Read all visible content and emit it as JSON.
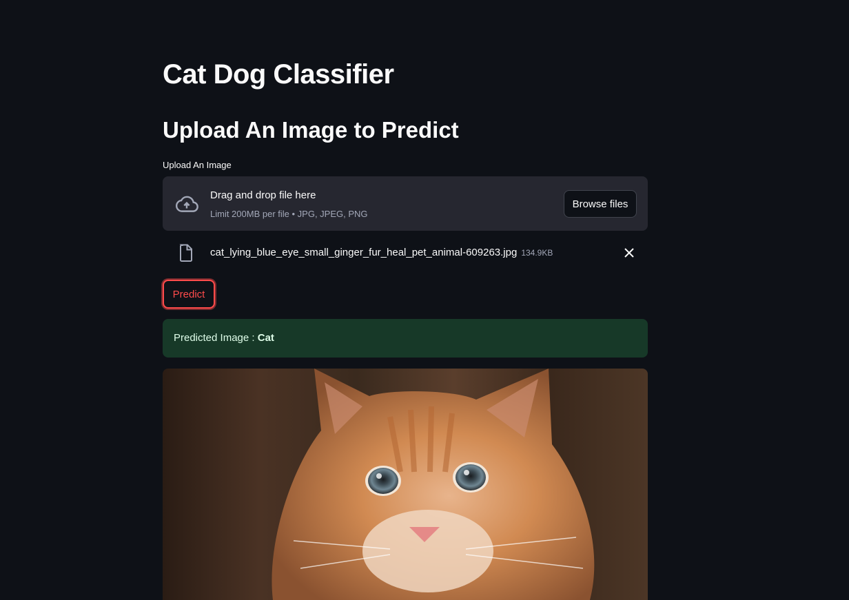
{
  "header": {
    "title": "Cat Dog Classifier",
    "subtitle": "Upload An Image to Predict"
  },
  "uploader": {
    "label": "Upload An Image",
    "drag_text": "Drag and drop file here",
    "limit_text": "Limit 200MB per file • JPG, JPEG, PNG",
    "browse_label": "Browse files",
    "icon": "cloud-upload-icon"
  },
  "uploaded_file": {
    "name": "cat_lying_blue_eye_small_ginger_fur_heal_pet_animal-609263.jpg",
    "size": "134.9KB",
    "icon": "file-icon"
  },
  "actions": {
    "predict_label": "Predict"
  },
  "result": {
    "prefix": "Predicted Image : ",
    "value": "Cat"
  },
  "colors": {
    "background": "#0e1117",
    "accent": "#ff4b4b",
    "success_bg": "#173928",
    "dropzone_bg": "#262730"
  }
}
